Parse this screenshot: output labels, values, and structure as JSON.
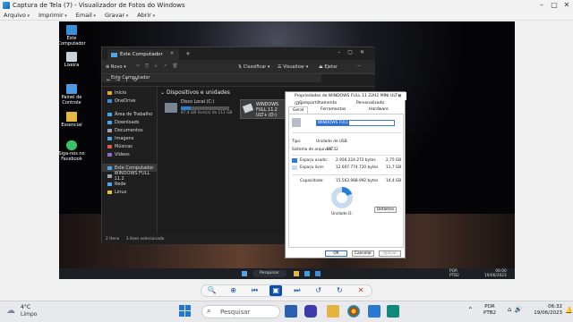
{
  "window": {
    "title": "Captura de Tela (7) - Visualizador de Fotos do Windows",
    "controls": [
      "–",
      "▢",
      "✕"
    ]
  },
  "menu": [
    "Arquivo",
    "Imprimir",
    "Email",
    "Gravar",
    "Abrir"
  ],
  "desktop_icons": [
    {
      "label": "Este Computador",
      "icon": "computer-icon",
      "color": "#3a8fd8"
    },
    {
      "label": "Lixeira",
      "icon": "recycle-bin-icon",
      "color": "#c9d3dc"
    },
    {
      "label": "Painel de Controle",
      "icon": "control-panel-icon",
      "color": "#4c9be0"
    },
    {
      "label": "Essencial",
      "icon": "folder-icon",
      "color": "#e7b744"
    },
    {
      "label": "Siga-nos no Facebook",
      "icon": "facebook-icon",
      "color": "#3cc16a"
    }
  ],
  "explorer": {
    "tab_title": "Este Computador",
    "toolbar": {
      "novo": "Novo",
      "classificar": "Classificar",
      "visualizar": "Visualizar",
      "ejetar": "Ejetar"
    },
    "address": "Este Computador",
    "sidebar": [
      {
        "label": "Início",
        "color": "#e6a23c"
      },
      {
        "label": "OneDrive",
        "color": "#3b8fe0"
      },
      {
        "label": "Área de Trabalho",
        "color": "#4fa3e8"
      },
      {
        "label": "Downloads",
        "color": "#4fa3e8"
      },
      {
        "label": "Documentos",
        "color": "#9aa4b0"
      },
      {
        "label": "Imagens",
        "color": "#4fa3e8"
      },
      {
        "label": "Músicas",
        "color": "#d6604d"
      },
      {
        "label": "Vídeos",
        "color": "#8d6cd9"
      },
      {
        "label": "Este Computador",
        "color": "#4fa3e8"
      },
      {
        "label": "WINDOWS FULL 11.2",
        "color": "#9aa4b0"
      },
      {
        "label": "Rede",
        "color": "#4fa3e8"
      },
      {
        "label": "Linux",
        "color": "#e6c23c"
      }
    ],
    "section_title": "Dispositivos e unidades",
    "drive_c": {
      "name": "Disco Local (C:)",
      "free": "87,4 GB livre(s) de 111 GB",
      "usage": 0.21
    },
    "drive_d": {
      "name": "WINDOWS FULL 11.2 ULT+ (D:)"
    },
    "status_left": "2 itens",
    "status_right": "1 item selecionado"
  },
  "properties": {
    "title": "Propriedades de WINDOWS FULL 11 22H2 MINI ULT+ (D:)",
    "tabs_top": [
      "Compartilhamento",
      "Personalizado"
    ],
    "tabs_bottom": [
      "Geral",
      "Ferramentas",
      "Hardware"
    ],
    "volume_label": "WINDOWS FULL",
    "tipo_label": "Tipo:",
    "tipo_value": "Unidade de USB",
    "fs_label": "Sistema de arquivos:",
    "fs_value": "FAT32",
    "used_label": "Espaço usado:",
    "used_bytes": "2.956.224.272 bytes",
    "used_gb": "2,75 GB",
    "free_label": "Espaço livre:",
    "free_bytes": "12.607.774.720 bytes",
    "free_gb": "11,7 GB",
    "cap_label": "Capacidade:",
    "cap_bytes": "15.563.988.992 bytes",
    "cap_gb": "14,4 GB",
    "drive_label": "Unidade D:",
    "details_btn": "Detalhes",
    "used_fraction": 0.19,
    "used_color": "#2d7fd6",
    "free_color": "#c8dcef",
    "buttons": [
      "OK",
      "Cancelar",
      "Aplicar"
    ]
  },
  "inner_taskbar": {
    "search": "Pesquisar",
    "lang": "POR PTB2",
    "time": "06:00",
    "date": "19/06/2023"
  },
  "viewer_toolbar": [
    "zoom-icon",
    "fit-icon",
    "previous-icon",
    "slideshow-icon",
    "next-icon",
    "rotate-left-icon",
    "rotate-right-icon",
    "delete-icon"
  ],
  "taskbar": {
    "temp": "4°C",
    "weather": "Limpo",
    "search": "Pesquisar",
    "lang_top": "POR",
    "lang_bottom": "PTB2",
    "time": "06:32",
    "date": "19/06/2023"
  }
}
